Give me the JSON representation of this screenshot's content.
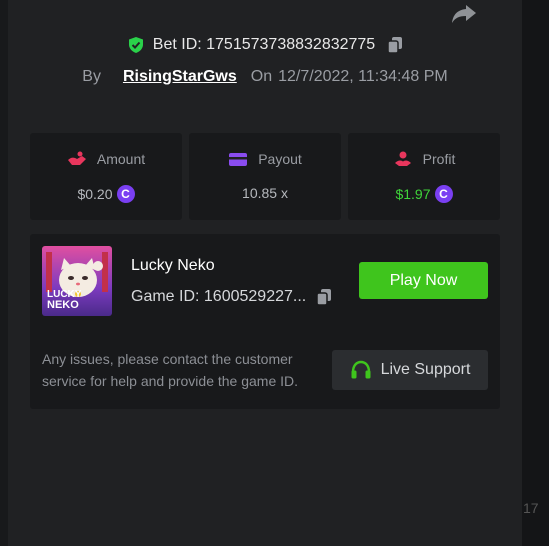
{
  "bet": {
    "id_text": "Bet ID: 1751573738832832775",
    "by_label": "By",
    "username": "RisingStarGws",
    "on_label": "On",
    "datetime": "12/7/2022, 11:34:48 PM"
  },
  "stats": {
    "amount": {
      "label": "Amount",
      "value": "$0.20"
    },
    "payout": {
      "label": "Payout",
      "value": "10.85 x"
    },
    "profit": {
      "label": "Profit",
      "value": "$1.97"
    }
  },
  "currency_symbol": "C",
  "game": {
    "name": "Lucky Neko",
    "id_text": "Game ID: 1600529227...",
    "thumb_logo_line1": "LUCKY",
    "thumb_logo_line2": "NEKO",
    "play_label": "Play Now"
  },
  "support": {
    "message": "Any issues, please contact the customer service for help and provide the game ID.",
    "button_label": "Live Support"
  },
  "background": {
    "peek_text": "17"
  },
  "colors": {
    "accent_green": "#3fc51d",
    "profit_green": "#3fd43a",
    "amount_icon": "#e8365d",
    "payout_icon": "#8a4cf0",
    "profit_icon": "#e8365d",
    "coin": "#7a3ff2",
    "shield": "#2ad14a"
  }
}
